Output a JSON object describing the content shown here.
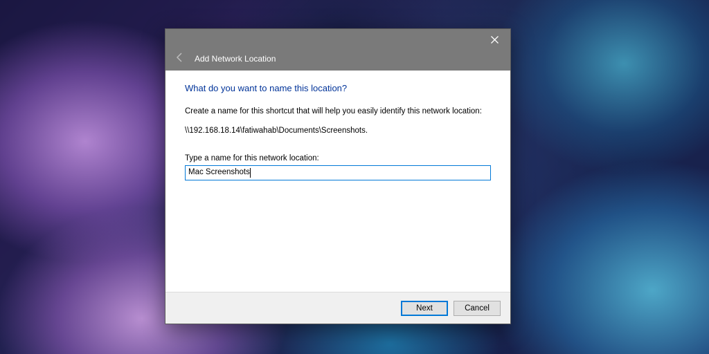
{
  "dialog": {
    "title": "Add Network Location",
    "heading": "What do you want to name this location?",
    "description": "Create a name for this shortcut that will help you easily identify this network location:",
    "path": "\\\\192.168.18.14\\fatiwahab\\Documents\\Screenshots.",
    "input_label": "Type a name for this network location:",
    "input_value": "Mac Screenshots"
  },
  "buttons": {
    "next": "Next",
    "cancel": "Cancel"
  }
}
